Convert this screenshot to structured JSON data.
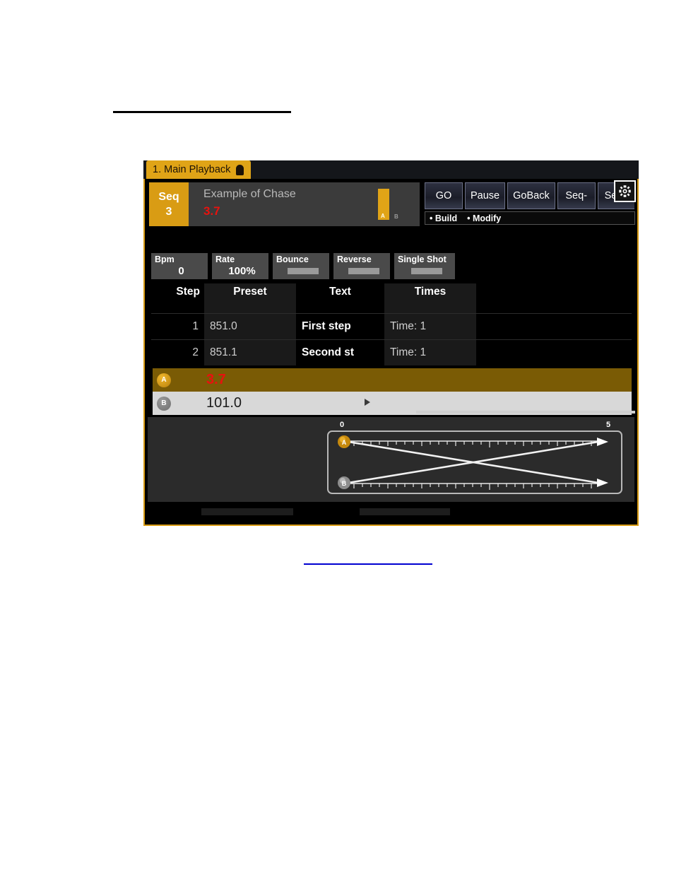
{
  "document": {
    "heading_rule": "",
    "link_rule": ""
  },
  "window": {
    "tab": {
      "label": "1. Main Playback",
      "lock_icon": "lock-icon"
    }
  },
  "header": {
    "seq_badge": {
      "label": "Seq",
      "number": "3"
    },
    "sequence_name": "Example of Chase",
    "sequence_value": "3.7",
    "fader": {
      "a_label": "A",
      "b_label": "B"
    },
    "command_buttons": [
      {
        "label": "GO"
      },
      {
        "label": "Pause"
      },
      {
        "label": "GoBack"
      },
      {
        "label": "Seq-"
      },
      {
        "label": "Seq+"
      }
    ],
    "build_modify": {
      "build": "Build",
      "modify": "Modify"
    },
    "gear_icon": "gear-icon"
  },
  "options": [
    {
      "label": "Bpm",
      "value": "0",
      "type": "value"
    },
    {
      "label": "Rate",
      "value": "100%",
      "type": "value"
    },
    {
      "label": "Bounce",
      "value": "",
      "type": "toggle"
    },
    {
      "label": "Reverse",
      "value": "",
      "type": "toggle"
    },
    {
      "label": "Single Shot",
      "value": "",
      "type": "toggle"
    }
  ],
  "step_table": {
    "columns": [
      "Step",
      "Preset",
      "Text",
      "Times"
    ],
    "rows": [
      {
        "step": "1",
        "preset": "851.0",
        "text": "First step",
        "times": "Time: 1"
      },
      {
        "step": "2",
        "preset": "851.1",
        "text": "Second st",
        "times": "Time: 1"
      }
    ]
  },
  "executors": [
    {
      "id": "A",
      "value": "3.7",
      "state": "active"
    },
    {
      "id": "B",
      "value": "101.0",
      "state": "selected"
    }
  ],
  "timeline": {
    "scale_start": "0",
    "scale_end": "5",
    "tracks": [
      {
        "id": "A",
        "direction": "down-right"
      },
      {
        "id": "B",
        "direction": "up-right"
      }
    ]
  },
  "colors": {
    "accent": "#d99c14",
    "tab_bg": "#e0a417",
    "alert_red": "#e8120e",
    "exec_a_bg": "#7a5b05",
    "exec_b_bg": "#d8d8d8",
    "panel_bg": "#2b2b2b",
    "link_blue": "#0000d0"
  }
}
